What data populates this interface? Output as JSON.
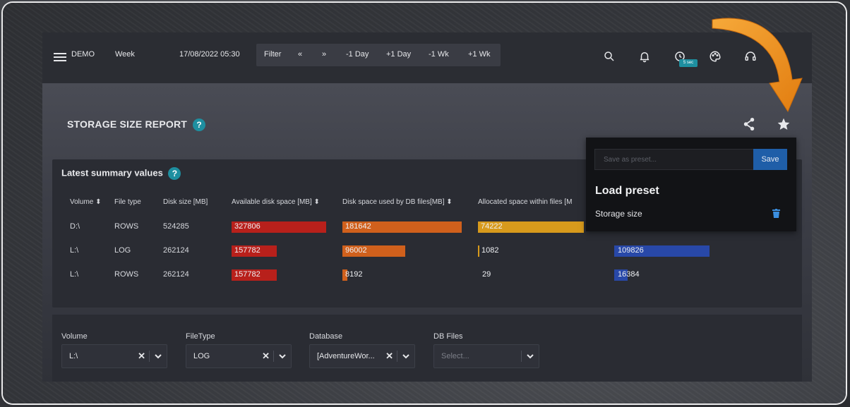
{
  "topbar": {
    "brand": "DEMO",
    "period": "Week",
    "datetime": "17/08/2022 05:30",
    "nav": [
      "Filter",
      "«",
      "»",
      "-1 Day",
      "+1 Day",
      "-1 Wk",
      "+1 Wk"
    ],
    "refresh_badge": "5 sec",
    "icons": [
      "search-icon",
      "bell-icon",
      "history-icon",
      "palette-icon",
      "headset-icon"
    ]
  },
  "page": {
    "title": "STORAGE SIZE REPORT",
    "help": "?"
  },
  "summary": {
    "title": "Latest summary values",
    "help": "?",
    "columns": [
      "Volume",
      "File type",
      "Disk size [MB]",
      "Available disk space [MB]",
      "Disk space used by DB files[MB]",
      "Allocated space within files [M"
    ],
    "rows": [
      {
        "volume": "D:\\",
        "file_type": "ROWS",
        "disk_size": "524285",
        "available": "327806",
        "used_by_db": "181642",
        "allocated": "74222",
        "extra": ""
      },
      {
        "volume": "L:\\",
        "file_type": "LOG",
        "disk_size": "262124",
        "available": "157782",
        "used_by_db": "96002",
        "allocated": "1082",
        "extra": "109826"
      },
      {
        "volume": "L:\\",
        "file_type": "ROWS",
        "disk_size": "262124",
        "available": "157782",
        "used_by_db": "8192",
        "allocated": "29",
        "extra": "16384"
      }
    ],
    "colors": {
      "available": "#b8201b",
      "used_by_db": "#d0601c",
      "allocated": "#d79a1c",
      "extra": "#2848a8"
    }
  },
  "filters": {
    "volume": {
      "label": "Volume",
      "value": "L:\\"
    },
    "filetype": {
      "label": "FileType",
      "value": "LOG"
    },
    "database": {
      "label": "Database",
      "value": "[AdventureWor..."
    },
    "dbfiles": {
      "label": "DB Files",
      "placeholder": "Select..."
    }
  },
  "preset_menu": {
    "input_placeholder": "Save as preset...",
    "save_label": "Save",
    "load_title": "Load preset",
    "items": [
      "Storage size"
    ]
  }
}
